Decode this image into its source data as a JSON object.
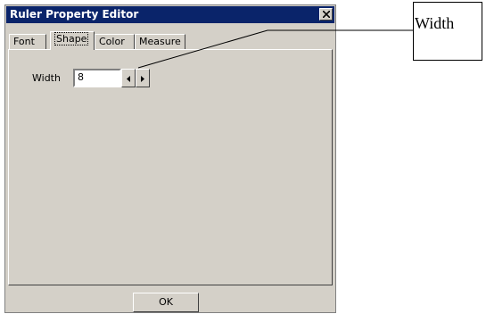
{
  "window": {
    "title": "Ruler Property Editor",
    "close_glyph": "×"
  },
  "tabs": [
    {
      "label": "Font",
      "active": false
    },
    {
      "label": "Shape",
      "active": true
    },
    {
      "label": "Color",
      "active": false
    },
    {
      "label": "Measure",
      "active": false
    }
  ],
  "shape_panel": {
    "width_label": "Width",
    "width_value": "8"
  },
  "footer": {
    "ok_label": "OK"
  },
  "callout": {
    "label": "Width"
  },
  "colors": {
    "titlebar": "#0a246a",
    "dialog_face": "#d4d0c8"
  },
  "icons": [
    "close-icon",
    "spin-left-arrow-icon",
    "spin-right-arrow-icon"
  ]
}
